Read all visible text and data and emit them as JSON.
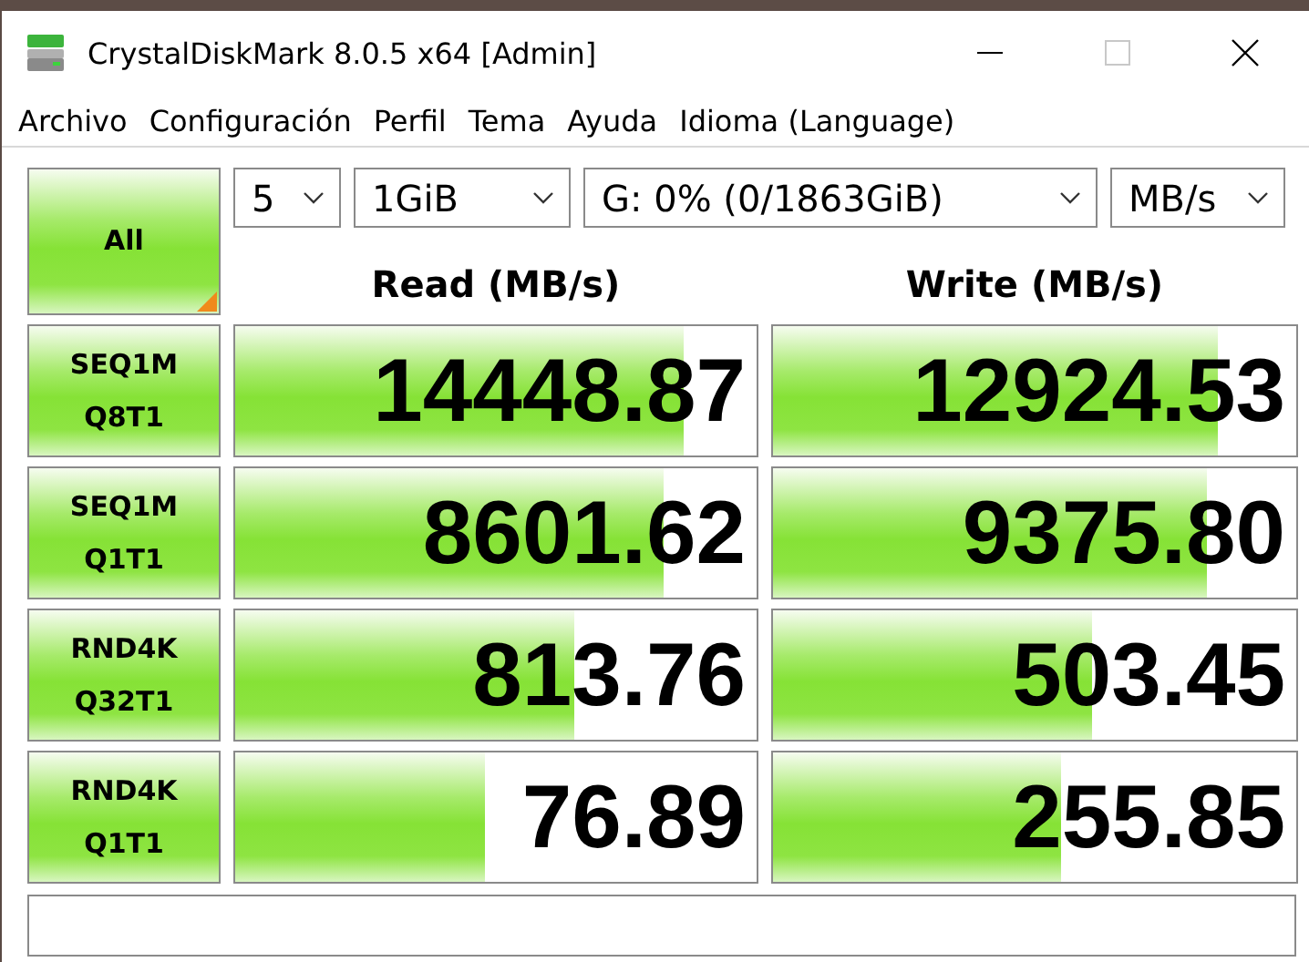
{
  "window": {
    "title": "CrystalDiskMark 8.0.5 x64 [Admin]",
    "maximize_disabled": true
  },
  "menu": [
    "Archivo",
    "Configuración",
    "Perfil",
    "Tema",
    "Ayuda",
    "Idioma (Language)"
  ],
  "all_button": {
    "label": "All"
  },
  "selectors": [
    {
      "value": "5"
    },
    {
      "value": "1GiB"
    },
    {
      "value": "G: 0% (0/1863GiB)"
    },
    {
      "value": "MB/s"
    }
  ],
  "columns": [
    "Read (MB/s)",
    "Write (MB/s)"
  ],
  "rows": [
    {
      "test": "SEQ1M",
      "params": "Q8T1",
      "read": {
        "value": "14448.87",
        "level": 0.86
      },
      "write": {
        "value": "12924.53",
        "level": 0.85
      }
    },
    {
      "test": "SEQ1M",
      "params": "Q1T1",
      "read": {
        "value": "8601.62",
        "level": 0.82
      },
      "write": {
        "value": "9375.80",
        "level": 0.83
      }
    },
    {
      "test": "RND4K",
      "params": "Q32T1",
      "read": {
        "value": "813.76",
        "level": 0.65
      },
      "write": {
        "value": "503.45",
        "level": 0.61
      }
    },
    {
      "test": "RND4K",
      "params": "Q1T1",
      "read": {
        "value": "76.89",
        "level": 0.48
      },
      "write": {
        "value": "255.85",
        "level": 0.55
      }
    }
  ]
}
